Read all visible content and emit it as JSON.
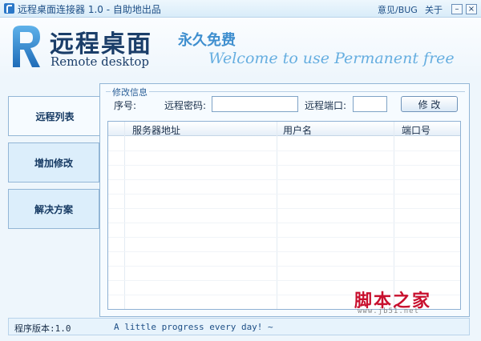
{
  "titlebar": {
    "title": "远程桌面连接器 1.0 - 自助地出品",
    "feedback": "意见/BUG",
    "about": "关于",
    "minimize": "–",
    "close": "×"
  },
  "banner": {
    "logo_cn": "远程桌面",
    "logo_en": "Remote desktop",
    "slogan_cn": "永久免费",
    "slogan_en": "Welcome to use  Permanent free"
  },
  "nav": {
    "items": [
      {
        "label": "远程列表",
        "active": true
      },
      {
        "label": "增加修改",
        "active": false
      },
      {
        "label": "解决方案",
        "active": false
      }
    ]
  },
  "edit": {
    "legend": "修改信息",
    "seq_label": "序号:",
    "password_label": "远程密码:",
    "password_value": "",
    "port_label": "远程端口:",
    "port_value": "",
    "modify_button": "修 改"
  },
  "table": {
    "columns": [
      "服务器地址",
      "用户名",
      "端口号"
    ],
    "rows": []
  },
  "status": {
    "version": "程序版本:1.0",
    "motto": "A little progress every day! ~"
  },
  "watermark": {
    "text": "脚本之家",
    "sub": "www.jb51.net"
  },
  "colors": {
    "accent": "#2b78c8",
    "panel_border": "#93b6d6",
    "background": "#eef6fc"
  }
}
